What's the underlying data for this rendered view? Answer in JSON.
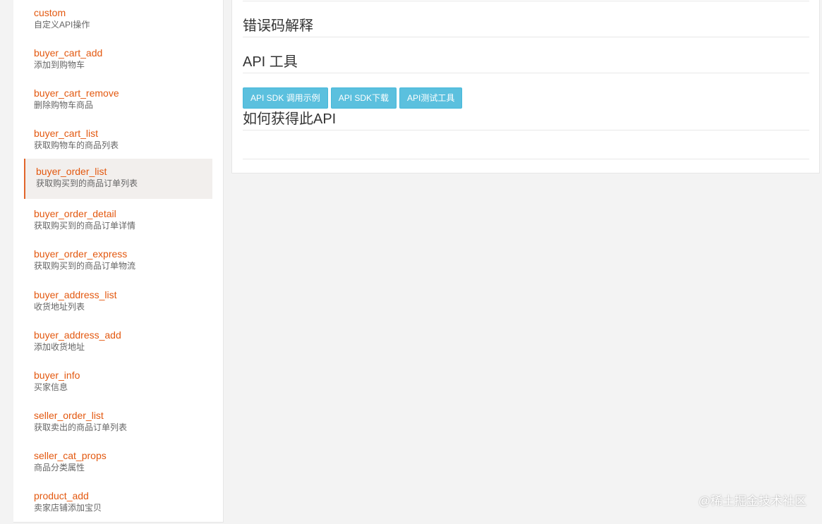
{
  "sidebar": {
    "items": [
      {
        "name": "custom",
        "desc": "自定义API操作"
      },
      {
        "name": "buyer_cart_add",
        "desc": "添加到购物车"
      },
      {
        "name": "buyer_cart_remove",
        "desc": "删除购物车商品"
      },
      {
        "name": "buyer_cart_list",
        "desc": "获取购物车的商品列表"
      },
      {
        "name": "buyer_order_list",
        "desc": "获取购买到的商品订单列表",
        "active": true
      },
      {
        "name": "buyer_order_detail",
        "desc": "获取购买到的商品订单详情"
      },
      {
        "name": "buyer_order_express",
        "desc": "获取购买到的商品订单物流"
      },
      {
        "name": "buyer_address_list",
        "desc": "收货地址列表"
      },
      {
        "name": "buyer_address_add",
        "desc": "添加收货地址"
      },
      {
        "name": "buyer_info",
        "desc": "买家信息"
      },
      {
        "name": "seller_order_list",
        "desc": "获取卖出的商品订单列表"
      },
      {
        "name": "seller_cat_props",
        "desc": "商品分类属性"
      },
      {
        "name": "product_add",
        "desc": "卖家店铺添加宝贝"
      }
    ]
  },
  "main": {
    "error_codes_title": "错误码解释",
    "api_tools_title": "API 工具",
    "buttons": {
      "sdk_example": "API SDK 调用示例",
      "sdk_download": "API SDK下载",
      "test_tool": "API测试工具"
    },
    "how_to_get_title": "如何获得此API"
  },
  "watermark": "@稀土掘金技术社区",
  "colors": {
    "link": "#e3580f",
    "active_border": "#e2662b",
    "button": "#5bc0de"
  }
}
